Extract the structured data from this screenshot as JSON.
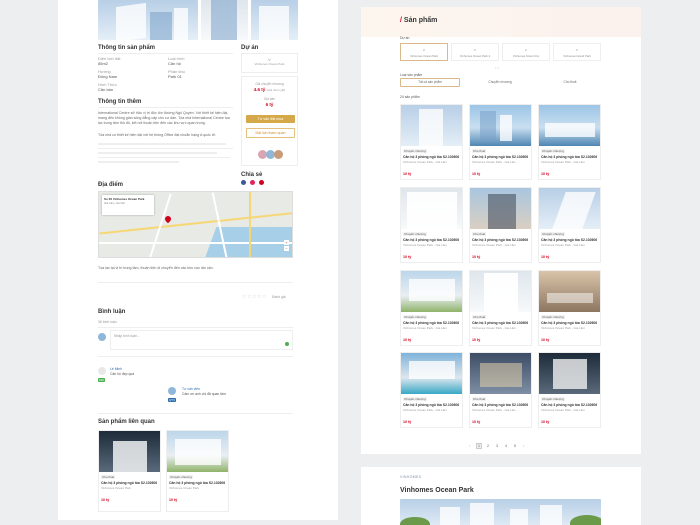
{
  "left": {
    "info_title": "Thông tin sản phẩm",
    "info": [
      {
        "label": "Diện tích đất",
        "value": "85m2"
      },
      {
        "label": "Loại hình",
        "value": "Căn hộ"
      },
      {
        "label": "Hướng",
        "value": "Đông Nam"
      },
      {
        "label": "Phân khu",
        "value": "Park 01"
      },
      {
        "label": "Hình Thức",
        "value": "Căn bán"
      }
    ],
    "project_title": "Dự án",
    "project_name": "Vinhomes Ocean Park",
    "ref_price_label": "Giá chuyển nhượng",
    "ref_price": "4.6 tỷ",
    "ref_price_note": "(Giá niêm yết)",
    "sell_label": "Giá bán",
    "sell_price": "6 tỷ",
    "btn_book": "Tư vấn đặt mua",
    "btn_visit": "Đặt lịch tham quan",
    "share_title": "Chia sẻ",
    "detail_title": "Thông tin thêm",
    "detail_text": "International Centre sở hữu vị trí độc tôn đường Ngô Quyền. Với thiết kế hiện đại, mang đến không gian sống đẳng cấp cho cư dân. Tòa nhà International Centre tọa lạc trung tâm thủ đô, kết nối thuận tiện đến các khu vực quan trọng.",
    "detail_text2": "Tòa nhà có thiết kế hiện đại với hệ thống Office đạt chuẩn hạng A quốc tế.",
    "location_title": "Địa điểm",
    "map_card_title": "Số 36 Vinhomes Ocean Park",
    "map_card_addr": "Gia Lâm, Hà Nội",
    "map_note": "Tọa lạc tại vị trí trung tâm, thuận tiện di chuyển đến các khu vực lân cận.",
    "rating_label": "Đánh giá",
    "comment_title": "Bình luận",
    "comment_count": "36 bình luận",
    "comment_placeholder": "Nhập bình luận...",
    "comments": [
      {
        "name": "Lê Minh",
        "text": "Căn hộ đẹp quá",
        "tag": "Mới"
      },
      {
        "name": "Tư vấn viên",
        "text": "Cảm ơn anh chị đã quan tâm",
        "tag": "QTV"
      }
    ],
    "related_title": "Sản phẩm liên quan",
    "related": [
      {
        "badge": "Cho thuê",
        "title": "Căn hộ 3 phòng ngủ tòa S2.102606",
        "sub": "Vinhomes Ocean Park",
        "price": "10 tỷ"
      },
      {
        "badge": "Chuyển nhượng",
        "title": "Căn hộ 3 phòng ngủ tòa S2.102606",
        "sub": "Vinhomes Ocean Park",
        "price": "10 tỷ"
      }
    ]
  },
  "right": {
    "heading_slash": "/",
    "heading": "Sản phẩm",
    "project_label": "Dự án",
    "projects": [
      "Vinhomes Ocean Park",
      "Vinhomes Ocean Park 2",
      "Vinhomes Smart City",
      "Vinhomes Grand Park"
    ],
    "type_label": "Loại sản phẩm",
    "types": [
      "Tất cả sản phẩm",
      "Chuyển nhượng",
      "Cho thuê"
    ],
    "result_count": "24 sản phẩm",
    "cards": [
      {
        "badge": "Chuyển nhượng",
        "title": "Căn hộ 3 phòng ngủ tòa S2.102606",
        "sub": "Vinhomes Ocean Park - Gia Lâm",
        "price": "10 tỷ"
      },
      {
        "badge": "Cho thuê",
        "title": "Căn hộ 3 phòng ngủ tòa S2.102606",
        "sub": "Vinhomes Ocean Park - Gia Lâm",
        "price": "10 tỷ"
      },
      {
        "badge": "Chuyển nhượng",
        "title": "Căn hộ 3 phòng ngủ tòa S2.102606",
        "sub": "Vinhomes Ocean Park - Gia Lâm",
        "price": "10 tỷ"
      },
      {
        "badge": "Chuyển nhượng",
        "title": "Căn hộ 3 phòng ngủ tòa S2.102606",
        "sub": "Vinhomes Ocean Park - Gia Lâm",
        "price": "10 tỷ"
      },
      {
        "badge": "Cho thuê",
        "title": "Căn hộ 3 phòng ngủ tòa S2.102606",
        "sub": "Vinhomes Ocean Park - Gia Lâm",
        "price": "10 tỷ"
      },
      {
        "badge": "Chuyển nhượng",
        "title": "Căn hộ 3 phòng ngủ tòa S2.102606",
        "sub": "Vinhomes Ocean Park - Gia Lâm",
        "price": "10 tỷ"
      },
      {
        "badge": "Chuyển nhượng",
        "title": "Căn hộ 3 phòng ngủ tòa S2.102606",
        "sub": "Vinhomes Ocean Park - Gia Lâm",
        "price": "10 tỷ"
      },
      {
        "badge": "Cho thuê",
        "title": "Căn hộ 3 phòng ngủ tòa S2.102606",
        "sub": "Vinhomes Ocean Park - Gia Lâm",
        "price": "10 tỷ"
      },
      {
        "badge": "Chuyển nhượng",
        "title": "Căn hộ 3 phòng ngủ tòa S2.102606",
        "sub": "Vinhomes Ocean Park - Gia Lâm",
        "price": "10 tỷ"
      },
      {
        "badge": "Chuyển nhượng",
        "title": "Căn hộ 3 phòng ngủ tòa S2.102606",
        "sub": "Vinhomes Ocean Park - Gia Lâm",
        "price": "10 tỷ"
      },
      {
        "badge": "Cho thuê",
        "title": "Căn hộ 3 phòng ngủ tòa S2.102606",
        "sub": "Vinhomes Ocean Park - Gia Lâm",
        "price": "10 tỷ"
      },
      {
        "badge": "Chuyển nhượng",
        "title": "Căn hộ 3 phòng ngủ tòa S2.102606",
        "sub": "Vinhomes Ocean Park - Gia Lâm",
        "price": "10 tỷ"
      }
    ],
    "pages": [
      "1",
      "2",
      "3",
      "4",
      "5"
    ]
  },
  "bottom": {
    "logo": "VINHOMES",
    "title": "Vinhomes Ocean Park"
  }
}
